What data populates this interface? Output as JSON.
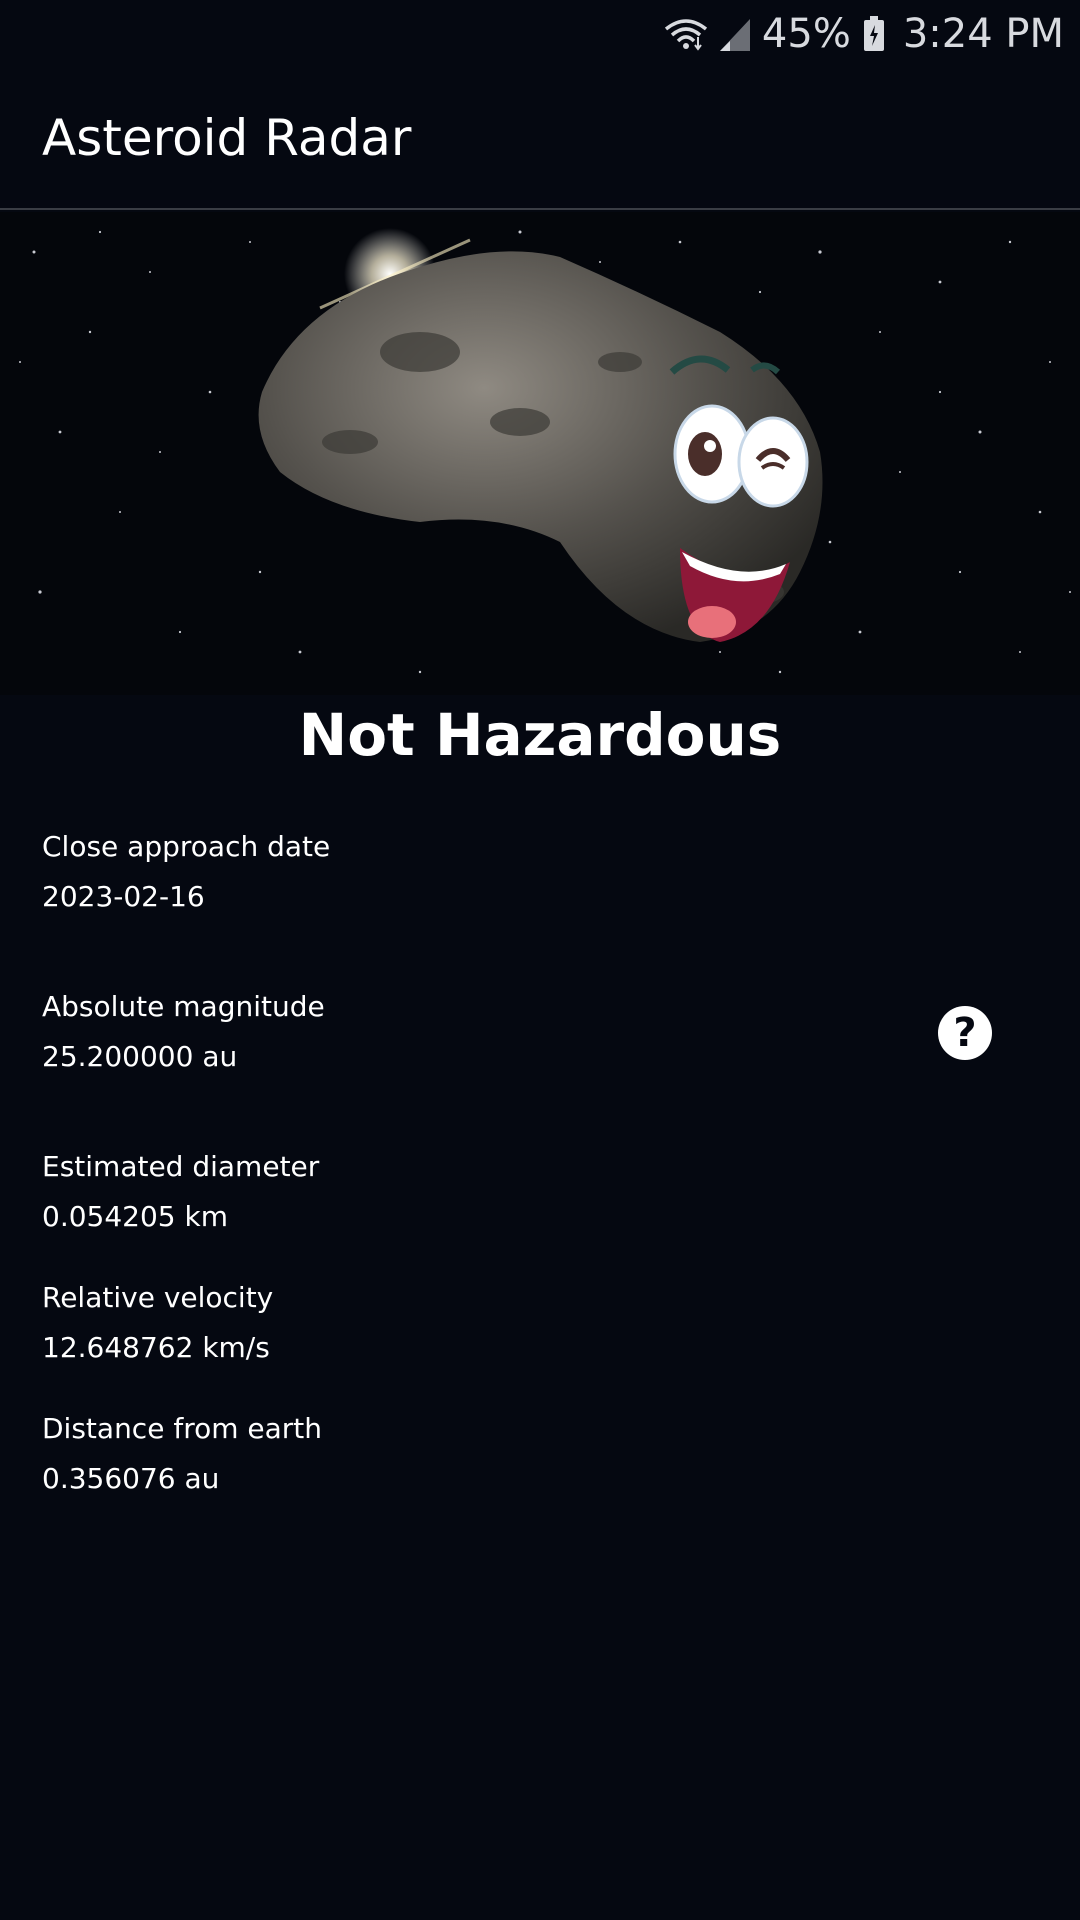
{
  "status_bar": {
    "battery_percent": "45%",
    "time": "3:24 PM",
    "icons": [
      "wifi-icon",
      "signal-icon",
      "battery-icon"
    ]
  },
  "app_bar": {
    "title": "Asteroid Radar"
  },
  "hero": {
    "image": "smiling-asteroid-image"
  },
  "hazard": {
    "status": "Not Hazardous"
  },
  "details": {
    "close_approach": {
      "label": "Close approach date",
      "value": "2023-02-16"
    },
    "absolute_magnitude": {
      "label": "Absolute magnitude",
      "value": "25.200000 au"
    },
    "estimated_diameter": {
      "label": "Estimated diameter",
      "value": "0.054205 km"
    },
    "relative_velocity": {
      "label": "Relative velocity",
      "value": "12.648762 km/s"
    },
    "distance_from_earth": {
      "label": "Distance from earth",
      "value": "0.356076 au"
    }
  },
  "help_button": {
    "glyph": "?"
  },
  "colors": {
    "background": "#050811",
    "text": "#ffffff",
    "status_text": "#d8dadf"
  }
}
